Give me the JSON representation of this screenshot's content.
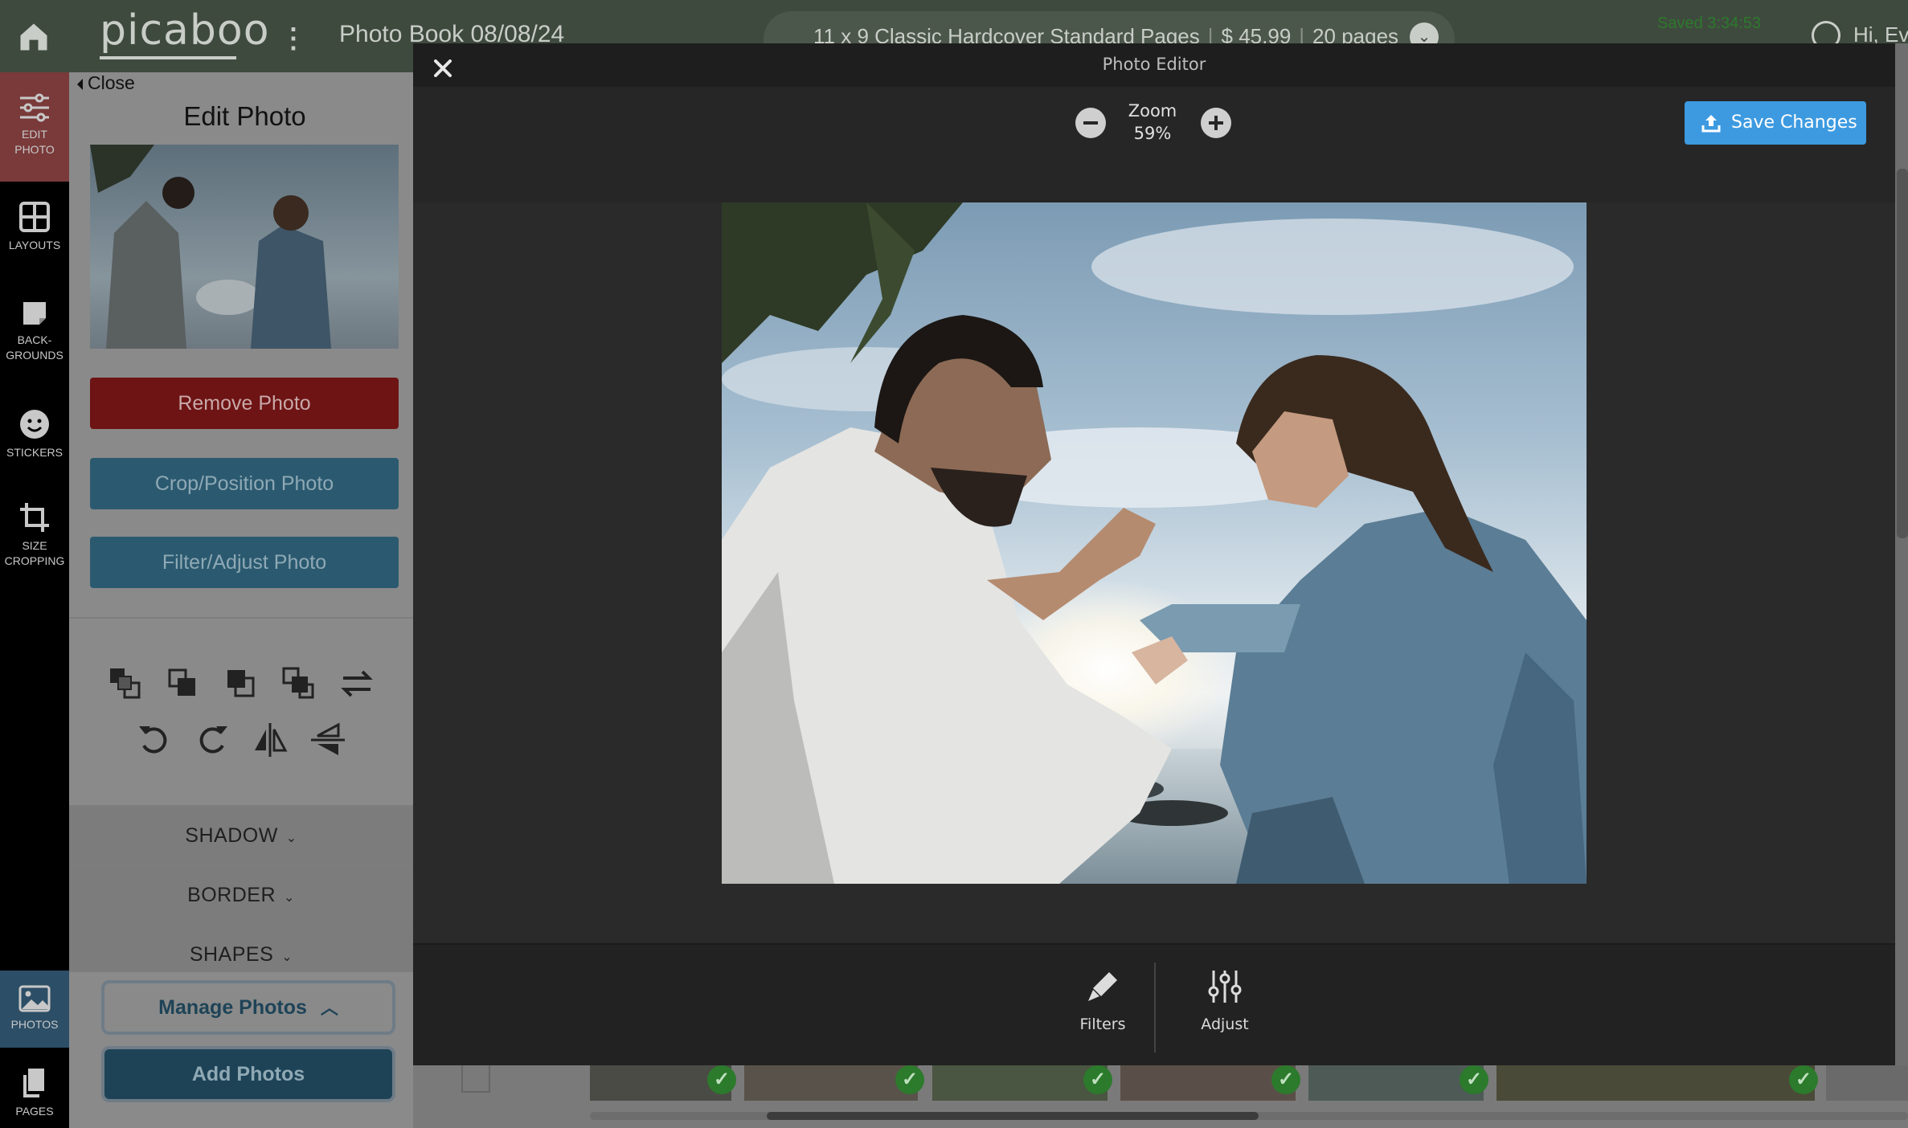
{
  "header": {
    "logo": "picaboo",
    "book_title": "Photo Book 08/08/24",
    "product": "11 x 9 Classic Hardcover Standard Pages",
    "price": "$ 45.99",
    "pages": "20 pages",
    "saved": "Saved 3:34:53",
    "greeting": "Hi, Ev"
  },
  "rail": {
    "items": [
      {
        "label_line1": "EDIT",
        "label_line2": "PHOTO"
      },
      {
        "label_line1": "LAYOUTS",
        "label_line2": ""
      },
      {
        "label_line1": "BACK-",
        "label_line2": "GROUNDS"
      },
      {
        "label_line1": "STICKERS",
        "label_line2": ""
      },
      {
        "label_line1": "SIZE",
        "label_line2": "CROPPING"
      },
      {
        "label_line1": "PHOTOS",
        "label_line2": ""
      },
      {
        "label_line1": "PAGES",
        "label_line2": ""
      }
    ]
  },
  "panel": {
    "close_label": "Close",
    "title": "Edit Photo",
    "remove_label": "Remove Photo",
    "crop_label": "Crop/Position Photo",
    "filter_label": "Filter/Adjust Photo",
    "shadow_label": "SHADOW",
    "border_label": "BORDER",
    "shapes_label": "SHAPES",
    "manage_label": "Manage Photos",
    "add_label": "Add Photos"
  },
  "editor": {
    "title": "Photo Editor",
    "zoom_label": "Zoom",
    "zoom_value": "59%",
    "save_label": "Save Changes",
    "filters_label": "Filters",
    "adjust_label": "Adjust"
  },
  "colors": {
    "save_button": "#3d9ae0",
    "remove_button": "#6e1414",
    "panel_button": "#2b5a70",
    "check_badge": "#2c7a2c"
  }
}
